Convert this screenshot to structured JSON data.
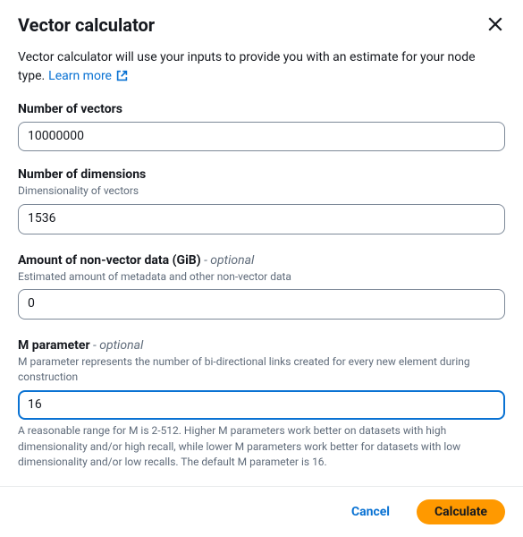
{
  "header": {
    "title": "Vector calculator"
  },
  "description": "Vector calculator will use your inputs to provide you with an estimate for your node type.",
  "learn_more": "Learn more",
  "fields": {
    "vectors": {
      "label": "Number of vectors",
      "value": "10000000"
    },
    "dimensions": {
      "label": "Number of dimensions",
      "hint": "Dimensionality of vectors",
      "value": "1536"
    },
    "nonvector": {
      "label": "Amount of non-vector data (GiB)",
      "optional": " - optional",
      "hint": "Estimated amount of metadata and other non-vector data",
      "value": "0"
    },
    "mparam": {
      "label": "M parameter",
      "optional": " - optional",
      "hint": "M parameter represents the number of bi-directional links created for every new element during construction",
      "value": "16",
      "help": "A reasonable range for M is 2-512. Higher M parameters work better on datasets with high dimensionality and/or high recall, while lower M parameters work better for datasets with low dimensionality and/or low recalls. The default M parameter is 16."
    }
  },
  "footer": {
    "cancel": "Cancel",
    "calculate": "Calculate"
  }
}
